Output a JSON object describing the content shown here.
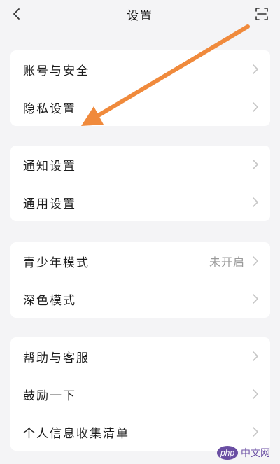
{
  "navbar": {
    "title": "设置",
    "back_icon": "chevron-left-icon",
    "scan_icon": "scan-icon"
  },
  "groups": [
    {
      "items": [
        {
          "label": "账号与安全"
        },
        {
          "label": "隐私设置"
        }
      ]
    },
    {
      "items": [
        {
          "label": "通知设置"
        },
        {
          "label": "通用设置"
        }
      ]
    },
    {
      "items": [
        {
          "label": "青少年模式",
          "value": "未开启"
        },
        {
          "label": "深色模式"
        }
      ]
    },
    {
      "items": [
        {
          "label": "帮助与客服"
        },
        {
          "label": "鼓励一下"
        },
        {
          "label": "个人信息收集清单"
        }
      ]
    }
  ],
  "annotation": {
    "color": "#f08a3c"
  },
  "watermark": {
    "logo": "php",
    "text": "中文网"
  },
  "colors": {
    "background": "#f4f4f6",
    "card": "#ffffff",
    "chevron": "#c6c6c6"
  }
}
